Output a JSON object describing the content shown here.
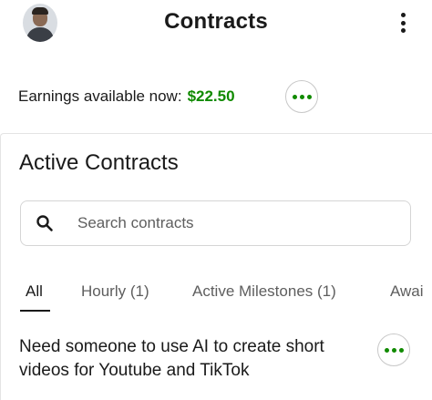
{
  "header": {
    "title": "Contracts",
    "avatar_icon": "user-avatar",
    "menu_icon": "kebab-menu-icon"
  },
  "earnings": {
    "label": "Earnings available now:",
    "amount": "$22.50"
  },
  "active_contracts": {
    "title": "Active Contracts",
    "search": {
      "placeholder": "Search contracts",
      "value": "",
      "icon": "search-icon"
    },
    "tabs": [
      {
        "label": "All",
        "active": true
      },
      {
        "label": "Hourly (1)",
        "active": false
      },
      {
        "label": "Active Milestones (1)",
        "active": false
      },
      {
        "label": "Awai",
        "active": false
      }
    ],
    "contracts": [
      {
        "title": "Need someone to use AI to create short videos for Youtube and TikTok"
      }
    ]
  },
  "colors": {
    "accent_green": "#108a00",
    "text": "#1a1a1a",
    "muted": "#5e5e5e",
    "border": "#d5d5d5"
  }
}
